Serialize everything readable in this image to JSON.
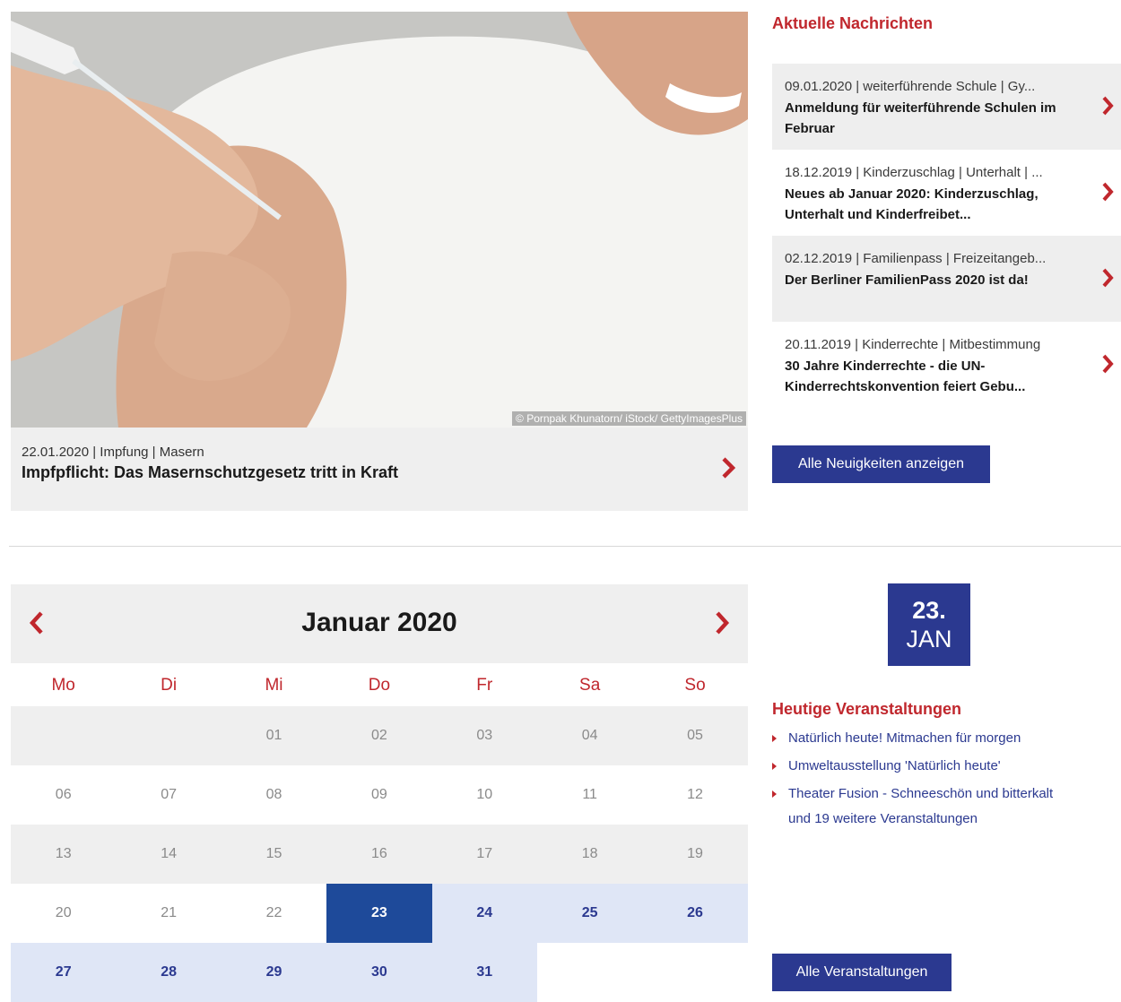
{
  "featured": {
    "image_credit": "© Pornpak Khunatorn/ iStock/ GettyImagesPlus",
    "meta": "22.01.2020 | Impfung | Masern",
    "title": "Impfpflicht: Das Masernschutzgesetz tritt in Kraft"
  },
  "news": {
    "heading": "Aktuelle Nachrichten",
    "items": [
      {
        "meta": "09.01.2020 | weiterführende Schule | Gy...",
        "title": "Anmeldung für weiterführende Schulen im Februar"
      },
      {
        "meta": "18.12.2019 | Kinderzuschlag | Unterhalt | ...",
        "title": "Neues ab Januar 2020: Kinderzuschlag, Unterhalt und Kinderfreibet..."
      },
      {
        "meta": "02.12.2019 | Familienpass | Freizeitangeb...",
        "title": "Der Berliner FamilienPass 2020 ist da!"
      },
      {
        "meta": "20.11.2019 | Kinderrechte | Mitbestimmung",
        "title": "30 Jahre Kinderrechte - die UN-Kinderrechtskonvention feiert Gebu..."
      }
    ],
    "all_button": "Alle Neuigkeiten anzeigen"
  },
  "calendar": {
    "month_label": "Januar 2020",
    "weekdays": [
      "Mo",
      "Di",
      "Mi",
      "Do",
      "Fr",
      "Sa",
      "So"
    ],
    "days": [
      "",
      "",
      "01",
      "02",
      "03",
      "04",
      "05",
      "06",
      "07",
      "08",
      "09",
      "10",
      "11",
      "12",
      "13",
      "14",
      "15",
      "16",
      "17",
      "18",
      "19",
      "20",
      "21",
      "22",
      "23",
      "24",
      "25",
      "26",
      "27",
      "28",
      "29",
      "30",
      "31",
      "",
      ""
    ],
    "today": "23"
  },
  "today_panel": {
    "badge_day": "23.",
    "badge_month": "JAN",
    "events_heading": "Heutige Veranstaltungen",
    "events": [
      "Natürlich heute! Mitmachen für morgen",
      "Umweltausstellung 'Natürlich heute'",
      "Theater Fusion - Schneeschön und bitterkalt"
    ],
    "more_events": "und 19 weitere Veranstaltungen",
    "all_button": "Alle Veranstaltungen"
  },
  "colors": {
    "accent_red": "#c0272d",
    "brand_blue": "#2b3990",
    "today_blue": "#1e4a9a",
    "future_day_bg": "#dfe6f6",
    "panel_gray": "#efefef"
  },
  "icons": {
    "arrow_right": "chevron-right-icon",
    "arrow_left": "chevron-left-icon"
  }
}
